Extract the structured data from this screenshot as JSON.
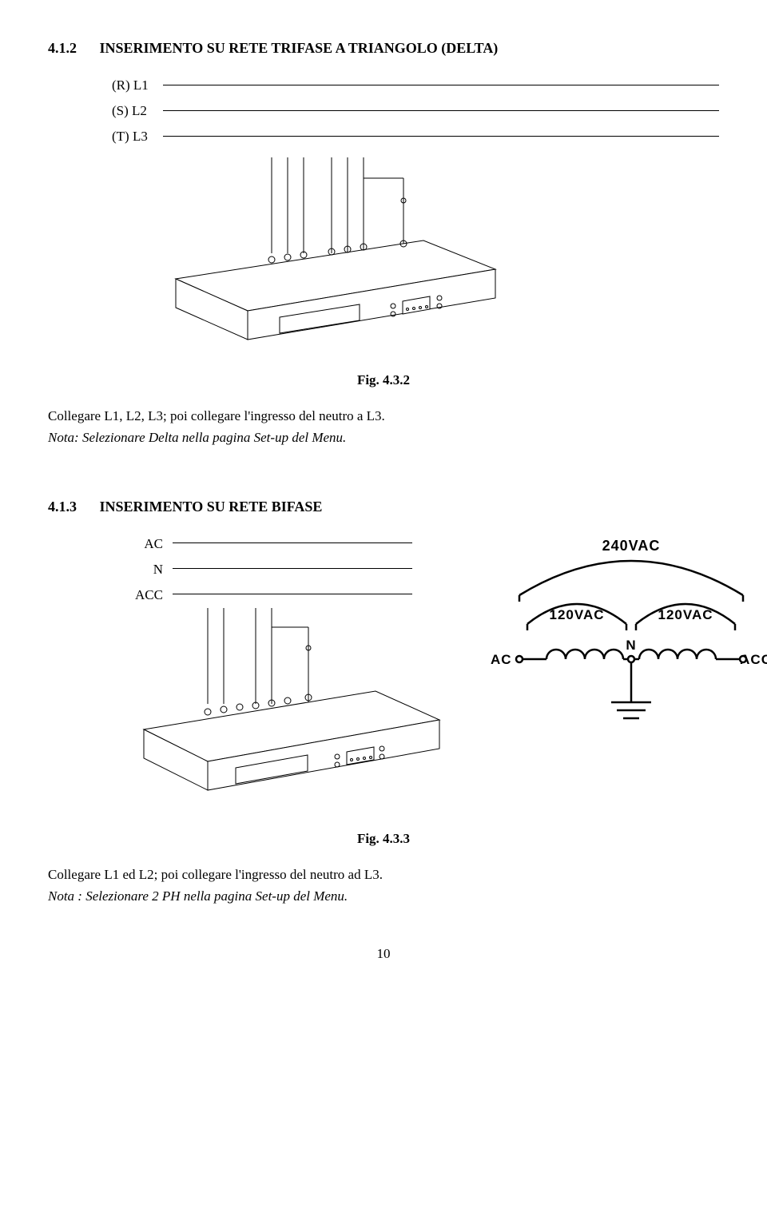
{
  "section1": {
    "num": "4.1.2",
    "title": "INSERIMENTO SU RETE TRIFASE A TRIANGOLO (DELTA)",
    "lines": {
      "l1": "(R) L1",
      "l2": "(S) L2",
      "l3": "(T) L3"
    },
    "caption": "Fig. 4.3.2",
    "text": "Collegare L1, L2, L3; poi collegare l'ingresso del neutro a L3.",
    "note": "Nota: Selezionare Delta nella pagina  Set-up  del Menu."
  },
  "section2": {
    "num": "4.1.3",
    "title": "INSERIMENTO SU RETE BIFASE",
    "lines": {
      "ac": "AC",
      "n": "N",
      "acc": "ACC"
    },
    "caption": "Fig. 4.3.3",
    "text": "Collegare L1 ed L2; poi collegare l'ingresso del neutro ad L3.",
    "note": "Nota : Selezionare 2 PH nella pagina Set-up del Menu.",
    "schematic": {
      "top": "240VAC",
      "left": "120VAC",
      "right": "120VAC",
      "al": "AC",
      "ar": "ACC",
      "n": "N"
    }
  },
  "page": "10"
}
